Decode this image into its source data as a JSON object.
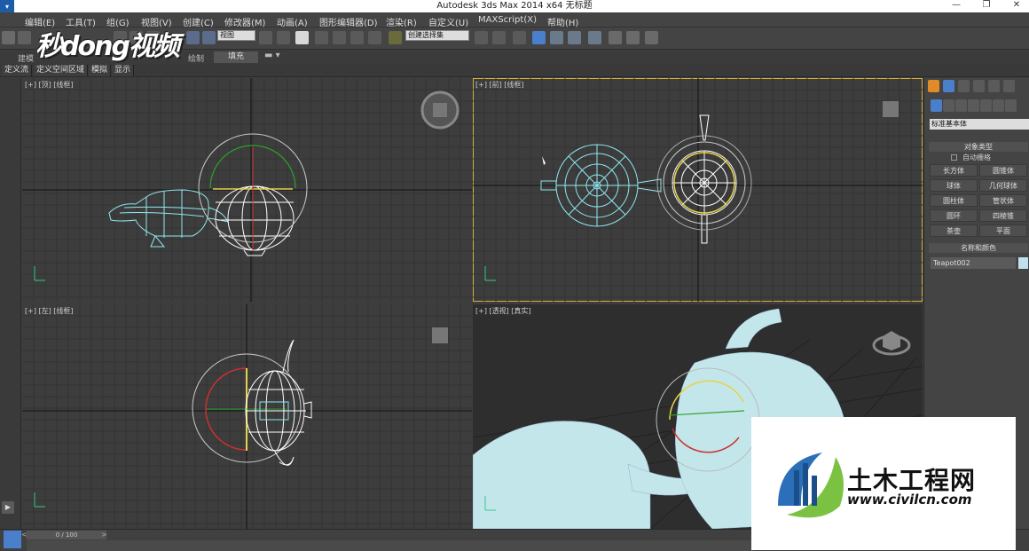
{
  "window": {
    "title": "Autodesk 3ds Max  2014 x64     无标题",
    "minimize": "—",
    "restore": "❐",
    "close": "✕",
    "app_icon": "3ds-max-logo"
  },
  "menu": [
    "编辑(E)",
    "工具(T)",
    "组(G)",
    "视图(V)",
    "创建(C)",
    "修改器(M)",
    "动画(A)",
    "图形编辑器(D)",
    "渲染(R)",
    "自定义(U)",
    "MAXScript(X)",
    "帮助(H)"
  ],
  "toolbar": {
    "ref_coord": "视图",
    "named_selection": "创建选择集"
  },
  "watermark": {
    "top_left": "秒dong视频"
  },
  "ribbon": {
    "tab1": "建模",
    "tab2": "绘制",
    "fill": "填充"
  },
  "ribbon2": [
    "定义流",
    "定义空间区域",
    "模拟",
    "显示"
  ],
  "viewports": {
    "top": "[+] [顶] [线框]",
    "front": "[+] [前] [线框]",
    "left": "[+] [左] [线框]",
    "persp": "[+] [透视] [真实]"
  },
  "command_panel": {
    "category": "标准基本体",
    "object_type_header": "对象类型",
    "auto_grid": "自动栅格",
    "objects": [
      "长方体",
      "圆锥体",
      "球体",
      "几何球体",
      "圆柱体",
      "管状体",
      "圆环",
      "四棱锥",
      "茶壶",
      "平面"
    ],
    "name_color_header": "名称和颜色",
    "object_name": "Teapot002",
    "object_color": "#bfe0ec"
  },
  "timeline": {
    "frame": "0 / 100",
    "prev": "<",
    "next": ">"
  },
  "logo": {
    "title": "土木工程网",
    "url": "www.civilcn.com"
  },
  "colors": {
    "bg": "#3d3d3d",
    "wire": "#8ee8f0",
    "selected_wire": "#ffffff",
    "active_border": "#d6b03a"
  }
}
